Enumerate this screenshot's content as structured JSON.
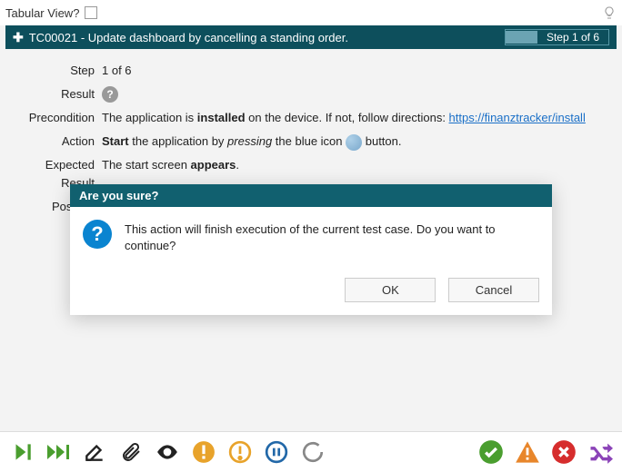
{
  "top": {
    "tabular_label": "Tabular View?"
  },
  "testcase": {
    "id_title": "TC00021 - Update dashboard by cancelling a standing order.",
    "step_badge": "Step 1 of 6"
  },
  "fields": {
    "step_label": "Step",
    "step_value": "1 of 6",
    "result_label": "Result",
    "precondition_label": "Precondition",
    "precondition_pre": "The application is ",
    "precondition_bold": "installed",
    "precondition_post": " on the device. If not, follow directions: ",
    "precondition_link": "https://finanztracker/install",
    "action_label": "Action",
    "action_bold": "Start",
    "action_mid": " the application by ",
    "action_italic": "pressing",
    "action_post1": " the blue icon ",
    "action_post2": " button.",
    "expected_label": "Expected Result",
    "expected_pre": "The start screen ",
    "expected_bold": "appears",
    "expected_post": ".",
    "postcondition_label": "Postcon"
  },
  "modal": {
    "title": "Are you sure?",
    "message": "This action will finish execution of the current test case. Do you want to continue?",
    "ok": "OK",
    "cancel": "Cancel"
  }
}
